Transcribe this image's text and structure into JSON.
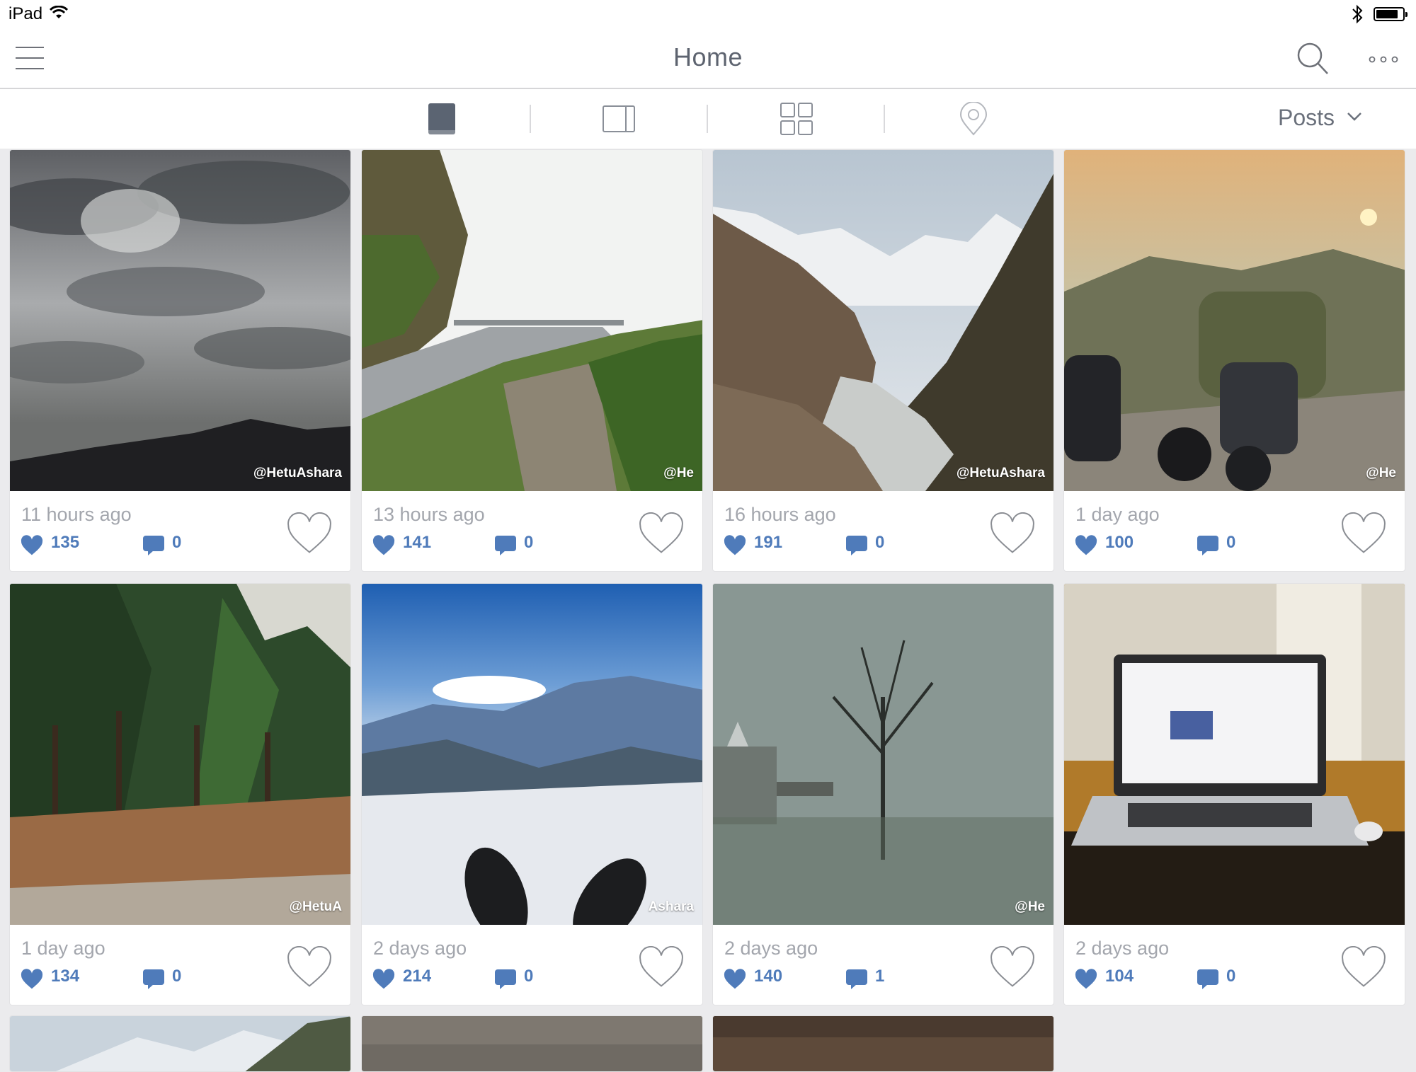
{
  "status": {
    "device": "iPad"
  },
  "nav": {
    "title": "Home"
  },
  "toolbar": {
    "filter_label": "Posts"
  },
  "posts": [
    {
      "time": "11 hours ago",
      "likes": "135",
      "comments": "0",
      "watermark": "@HetuAshara",
      "scene": "clouds"
    },
    {
      "time": "13 hours ago",
      "likes": "141",
      "comments": "0",
      "watermark": "@He",
      "scene": "road"
    },
    {
      "time": "16 hours ago",
      "likes": "191",
      "comments": "0",
      "watermark": "@HetuAshara",
      "scene": "valley"
    },
    {
      "time": "1 day ago",
      "likes": "100",
      "comments": "0",
      "watermark": "@He",
      "scene": "scooter"
    },
    {
      "time": "1 day ago",
      "likes": "134",
      "comments": "0",
      "watermark": "@HetuA",
      "scene": "forest"
    },
    {
      "time": "2 days ago",
      "likes": "214",
      "comments": "0",
      "watermark": "Ashara",
      "scene": "snow"
    },
    {
      "time": "2 days ago",
      "likes": "140",
      "comments": "1",
      "watermark": "@He",
      "scene": "lake"
    },
    {
      "time": "2 days ago",
      "likes": "104",
      "comments": "0",
      "watermark": "",
      "scene": "laptop"
    }
  ],
  "colors": {
    "accent": "#4f7bba",
    "background": "#ebebed"
  }
}
